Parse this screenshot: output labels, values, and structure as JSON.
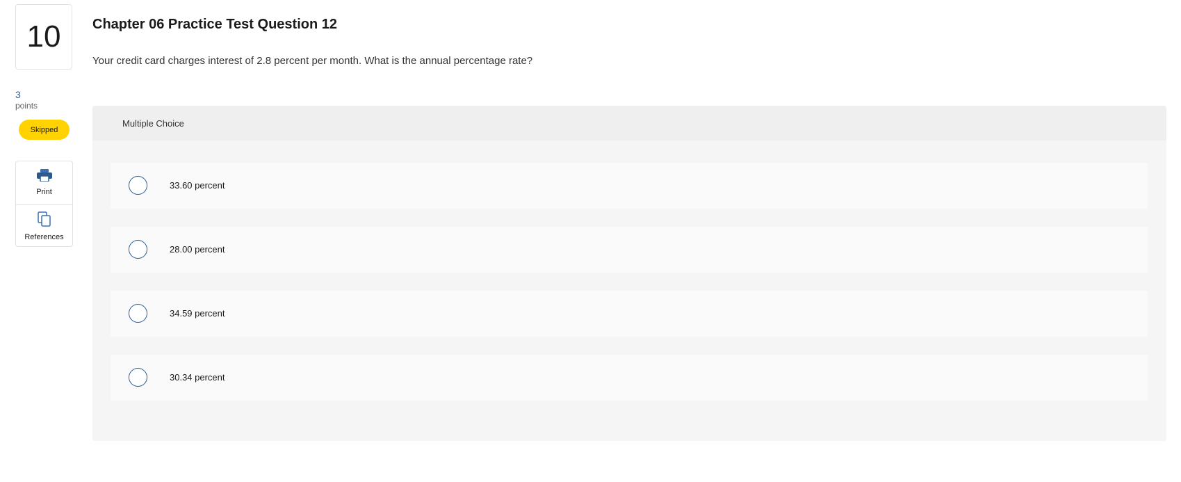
{
  "question": {
    "number": "10",
    "points_value": "3",
    "points_label": "points",
    "status": "Skipped",
    "title": "Chapter 06 Practice Test Question 12",
    "text": "Your credit card charges interest of 2.8 percent per month. What is the annual percentage rate?"
  },
  "tools": {
    "print": {
      "label": "Print",
      "icon": "printer-icon"
    },
    "references": {
      "label": "References",
      "icon": "references-icon"
    }
  },
  "answer_panel": {
    "type_label": "Multiple Choice",
    "options": [
      {
        "label": "33.60 percent",
        "selected": false
      },
      {
        "label": "28.00 percent",
        "selected": false
      },
      {
        "label": "34.59 percent",
        "selected": false
      },
      {
        "label": "30.34 percent",
        "selected": false
      }
    ]
  },
  "colors": {
    "accent": "#2d5a8c",
    "badge": "#ffd200",
    "panel_bg": "#f5f5f5"
  }
}
